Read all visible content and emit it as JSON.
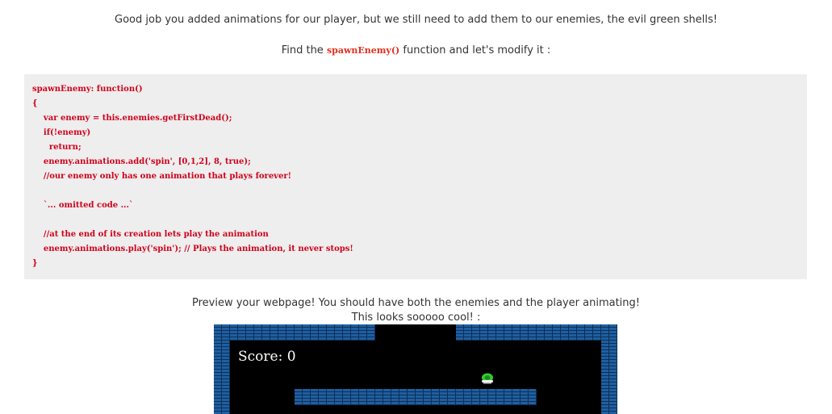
{
  "intro_text": "Good job you added animations for our player, but we still need to add them to our enemies, the evil green shells!",
  "find_text": {
    "before": "Find the ",
    "code": "spawnEnemy()",
    "after": " function and let's modify it :"
  },
  "code_lines": [
    "spawnEnemy: function()",
    "{",
    "    var enemy = this.enemies.getFirstDead();",
    "    if(!enemy)",
    "      return;",
    "    enemy.animations.add('spin', [0,1,2], 8, true);",
    "    //our enemy only has one animation that plays forever!",
    "",
    "    `... omitted code ...`",
    "",
    "    //at the end of its creation lets play the animation",
    "    enemy.animations.play('spin'); // Plays the animation, it never stops!",
    "}"
  ],
  "preview_line1": "Preview your webpage! You should have both the enemies and the player animating!",
  "preview_line2": "This looks sooooo cool! :",
  "game": {
    "score_text": "Score: 0",
    "colors": {
      "background": "#000000",
      "brick": "#1f5fa0",
      "mortar": "#0c2f58",
      "shell": "#33cc33"
    },
    "icons": [
      "green-shell-icon"
    ]
  }
}
